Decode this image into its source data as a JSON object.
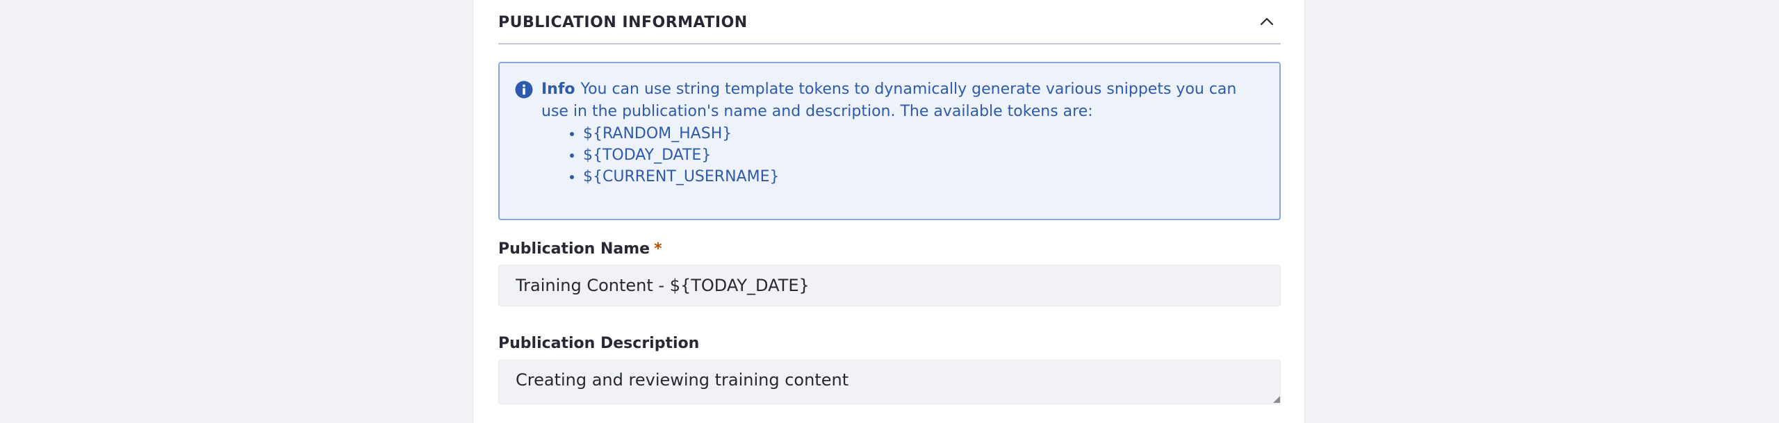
{
  "section": {
    "title": "PUBLICATION INFORMATION"
  },
  "info_alert": {
    "lead": "Info",
    "message": "You can use string template tokens to dynamically generate various snippets you can use in the publication's name and description. The available tokens are:",
    "tokens": [
      "${RANDOM_HASH}",
      "${TODAY_DATE}",
      "${CURRENT_USERNAME}"
    ]
  },
  "name_field": {
    "label": "Publication Name",
    "required_mark": "*",
    "value": "Training Content - ${TODAY_DATE}"
  },
  "description_field": {
    "label": "Publication Description",
    "value": "Creating and reviewing training content"
  },
  "colors": {
    "page_background": "#f1f2f5",
    "card_background": "#ffffff",
    "alert_text": "#2e5aac",
    "alert_border": "#89a7e0",
    "alert_background": "#eef2fa",
    "required": "#b95000"
  }
}
